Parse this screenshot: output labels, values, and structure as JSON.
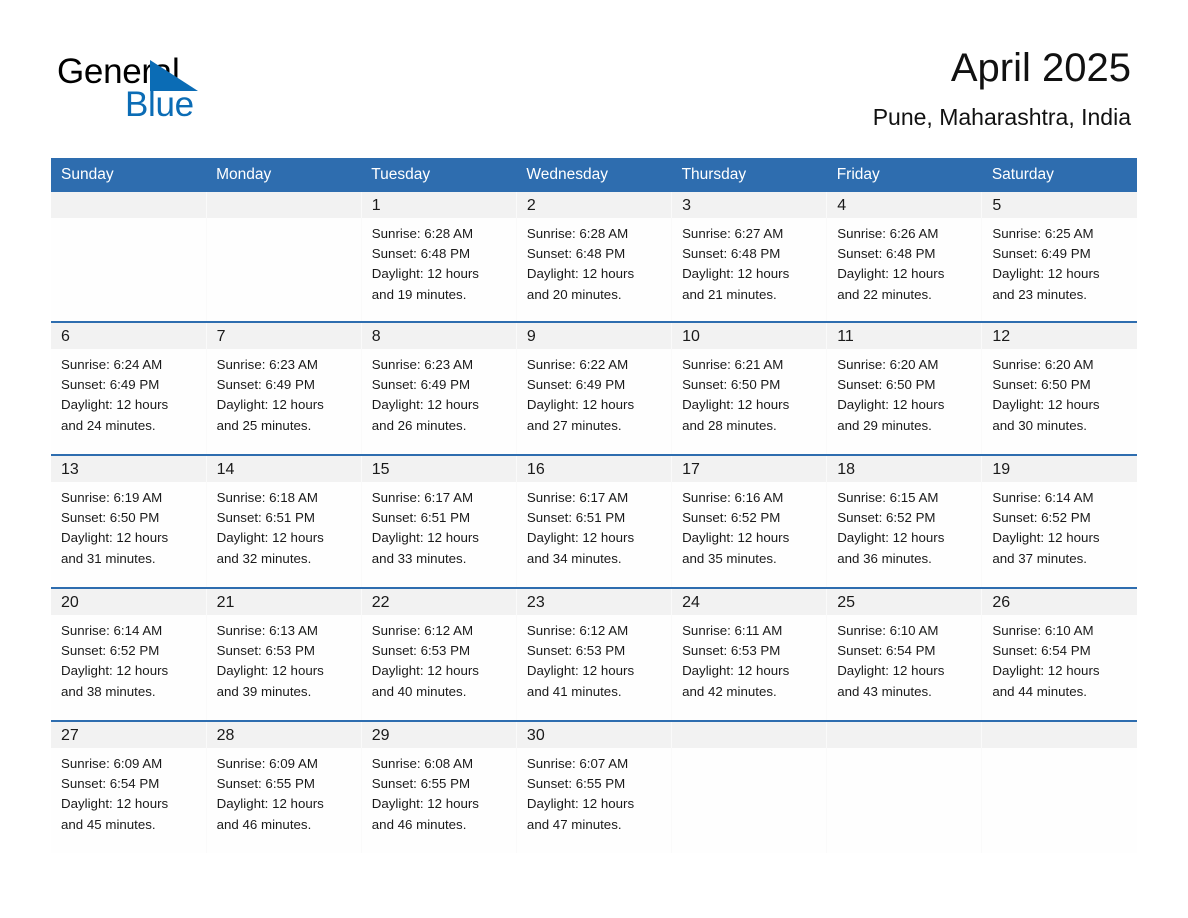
{
  "brand": {
    "name_part1": "General",
    "name_part2": "Blue",
    "accent_color": "#0b6cb5"
  },
  "header": {
    "title": "April 2025",
    "subtitle": "Pune, Maharashtra, India"
  },
  "theme": {
    "header_blue": "#2e6daf",
    "daynum_band": "#f2f2f2",
    "cell_bg": "#fefefe"
  },
  "weekdays": [
    "Sunday",
    "Monday",
    "Tuesday",
    "Wednesday",
    "Thursday",
    "Friday",
    "Saturday"
  ],
  "labels": {
    "sunrise_prefix": "Sunrise:",
    "sunset_prefix": "Sunset:",
    "daylight_prefix": "Daylight:"
  },
  "weeks": [
    [
      {
        "day": "",
        "empty": true
      },
      {
        "day": "",
        "empty": true
      },
      {
        "day": "1",
        "sunrise": "Sunrise: 6:28 AM",
        "sunset": "Sunset: 6:48 PM",
        "daylight_l1": "Daylight: 12 hours",
        "daylight_l2": "and 19 minutes."
      },
      {
        "day": "2",
        "sunrise": "Sunrise: 6:28 AM",
        "sunset": "Sunset: 6:48 PM",
        "daylight_l1": "Daylight: 12 hours",
        "daylight_l2": "and 20 minutes."
      },
      {
        "day": "3",
        "sunrise": "Sunrise: 6:27 AM",
        "sunset": "Sunset: 6:48 PM",
        "daylight_l1": "Daylight: 12 hours",
        "daylight_l2": "and 21 minutes."
      },
      {
        "day": "4",
        "sunrise": "Sunrise: 6:26 AM",
        "sunset": "Sunset: 6:48 PM",
        "daylight_l1": "Daylight: 12 hours",
        "daylight_l2": "and 22 minutes."
      },
      {
        "day": "5",
        "sunrise": "Sunrise: 6:25 AM",
        "sunset": "Sunset: 6:49 PM",
        "daylight_l1": "Daylight: 12 hours",
        "daylight_l2": "and 23 minutes."
      }
    ],
    [
      {
        "day": "6",
        "sunrise": "Sunrise: 6:24 AM",
        "sunset": "Sunset: 6:49 PM",
        "daylight_l1": "Daylight: 12 hours",
        "daylight_l2": "and 24 minutes."
      },
      {
        "day": "7",
        "sunrise": "Sunrise: 6:23 AM",
        "sunset": "Sunset: 6:49 PM",
        "daylight_l1": "Daylight: 12 hours",
        "daylight_l2": "and 25 minutes."
      },
      {
        "day": "8",
        "sunrise": "Sunrise: 6:23 AM",
        "sunset": "Sunset: 6:49 PM",
        "daylight_l1": "Daylight: 12 hours",
        "daylight_l2": "and 26 minutes."
      },
      {
        "day": "9",
        "sunrise": "Sunrise: 6:22 AM",
        "sunset": "Sunset: 6:49 PM",
        "daylight_l1": "Daylight: 12 hours",
        "daylight_l2": "and 27 minutes."
      },
      {
        "day": "10",
        "sunrise": "Sunrise: 6:21 AM",
        "sunset": "Sunset: 6:50 PM",
        "daylight_l1": "Daylight: 12 hours",
        "daylight_l2": "and 28 minutes."
      },
      {
        "day": "11",
        "sunrise": "Sunrise: 6:20 AM",
        "sunset": "Sunset: 6:50 PM",
        "daylight_l1": "Daylight: 12 hours",
        "daylight_l2": "and 29 minutes."
      },
      {
        "day": "12",
        "sunrise": "Sunrise: 6:20 AM",
        "sunset": "Sunset: 6:50 PM",
        "daylight_l1": "Daylight: 12 hours",
        "daylight_l2": "and 30 minutes."
      }
    ],
    [
      {
        "day": "13",
        "sunrise": "Sunrise: 6:19 AM",
        "sunset": "Sunset: 6:50 PM",
        "daylight_l1": "Daylight: 12 hours",
        "daylight_l2": "and 31 minutes."
      },
      {
        "day": "14",
        "sunrise": "Sunrise: 6:18 AM",
        "sunset": "Sunset: 6:51 PM",
        "daylight_l1": "Daylight: 12 hours",
        "daylight_l2": "and 32 minutes."
      },
      {
        "day": "15",
        "sunrise": "Sunrise: 6:17 AM",
        "sunset": "Sunset: 6:51 PM",
        "daylight_l1": "Daylight: 12 hours",
        "daylight_l2": "and 33 minutes."
      },
      {
        "day": "16",
        "sunrise": "Sunrise: 6:17 AM",
        "sunset": "Sunset: 6:51 PM",
        "daylight_l1": "Daylight: 12 hours",
        "daylight_l2": "and 34 minutes."
      },
      {
        "day": "17",
        "sunrise": "Sunrise: 6:16 AM",
        "sunset": "Sunset: 6:52 PM",
        "daylight_l1": "Daylight: 12 hours",
        "daylight_l2": "and 35 minutes."
      },
      {
        "day": "18",
        "sunrise": "Sunrise: 6:15 AM",
        "sunset": "Sunset: 6:52 PM",
        "daylight_l1": "Daylight: 12 hours",
        "daylight_l2": "and 36 minutes."
      },
      {
        "day": "19",
        "sunrise": "Sunrise: 6:14 AM",
        "sunset": "Sunset: 6:52 PM",
        "daylight_l1": "Daylight: 12 hours",
        "daylight_l2": "and 37 minutes."
      }
    ],
    [
      {
        "day": "20",
        "sunrise": "Sunrise: 6:14 AM",
        "sunset": "Sunset: 6:52 PM",
        "daylight_l1": "Daylight: 12 hours",
        "daylight_l2": "and 38 minutes."
      },
      {
        "day": "21",
        "sunrise": "Sunrise: 6:13 AM",
        "sunset": "Sunset: 6:53 PM",
        "daylight_l1": "Daylight: 12 hours",
        "daylight_l2": "and 39 minutes."
      },
      {
        "day": "22",
        "sunrise": "Sunrise: 6:12 AM",
        "sunset": "Sunset: 6:53 PM",
        "daylight_l1": "Daylight: 12 hours",
        "daylight_l2": "and 40 minutes."
      },
      {
        "day": "23",
        "sunrise": "Sunrise: 6:12 AM",
        "sunset": "Sunset: 6:53 PM",
        "daylight_l1": "Daylight: 12 hours",
        "daylight_l2": "and 41 minutes."
      },
      {
        "day": "24",
        "sunrise": "Sunrise: 6:11 AM",
        "sunset": "Sunset: 6:53 PM",
        "daylight_l1": "Daylight: 12 hours",
        "daylight_l2": "and 42 minutes."
      },
      {
        "day": "25",
        "sunrise": "Sunrise: 6:10 AM",
        "sunset": "Sunset: 6:54 PM",
        "daylight_l1": "Daylight: 12 hours",
        "daylight_l2": "and 43 minutes."
      },
      {
        "day": "26",
        "sunrise": "Sunrise: 6:10 AM",
        "sunset": "Sunset: 6:54 PM",
        "daylight_l1": "Daylight: 12 hours",
        "daylight_l2": "and 44 minutes."
      }
    ],
    [
      {
        "day": "27",
        "sunrise": "Sunrise: 6:09 AM",
        "sunset": "Sunset: 6:54 PM",
        "daylight_l1": "Daylight: 12 hours",
        "daylight_l2": "and 45 minutes."
      },
      {
        "day": "28",
        "sunrise": "Sunrise: 6:09 AM",
        "sunset": "Sunset: 6:55 PM",
        "daylight_l1": "Daylight: 12 hours",
        "daylight_l2": "and 46 minutes."
      },
      {
        "day": "29",
        "sunrise": "Sunrise: 6:08 AM",
        "sunset": "Sunset: 6:55 PM",
        "daylight_l1": "Daylight: 12 hours",
        "daylight_l2": "and 46 minutes."
      },
      {
        "day": "30",
        "sunrise": "Sunrise: 6:07 AM",
        "sunset": "Sunset: 6:55 PM",
        "daylight_l1": "Daylight: 12 hours",
        "daylight_l2": "and 47 minutes."
      },
      {
        "day": "",
        "empty": true
      },
      {
        "day": "",
        "empty": true
      },
      {
        "day": "",
        "empty": true
      }
    ]
  ]
}
